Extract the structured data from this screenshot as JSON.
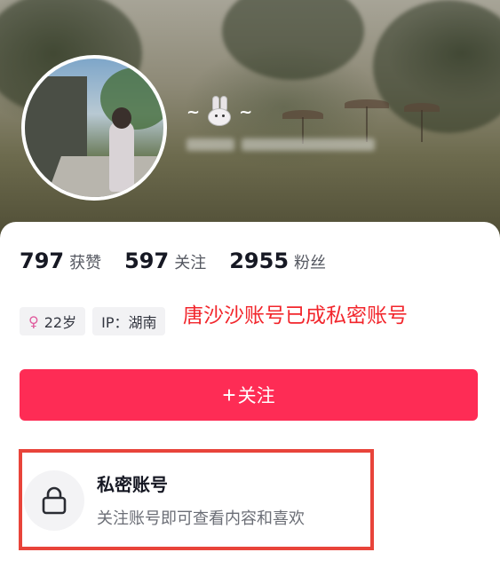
{
  "profile": {
    "name_prefix": "~",
    "name_suffix": "~"
  },
  "stats": [
    {
      "value": "797",
      "label": "获赞"
    },
    {
      "value": "597",
      "label": "关注"
    },
    {
      "value": "2955",
      "label": "粉丝"
    }
  ],
  "tags": {
    "age": "22岁",
    "ip": "IP：湖南"
  },
  "overlay_note": "唐沙沙账号已成私密账号",
  "follow_button": {
    "plus": "+",
    "label": "关注"
  },
  "private_notice": {
    "title": "私密账号",
    "subtitle": "关注账号即可查看内容和喜欢"
  },
  "colors": {
    "follow_button": "#fe2c55",
    "note_red": "#f2262c",
    "box_border": "#e8443a"
  },
  "icons": {
    "name_emoji": "rabbit-icon",
    "gender": "female-icon",
    "lock": "lock-icon"
  }
}
